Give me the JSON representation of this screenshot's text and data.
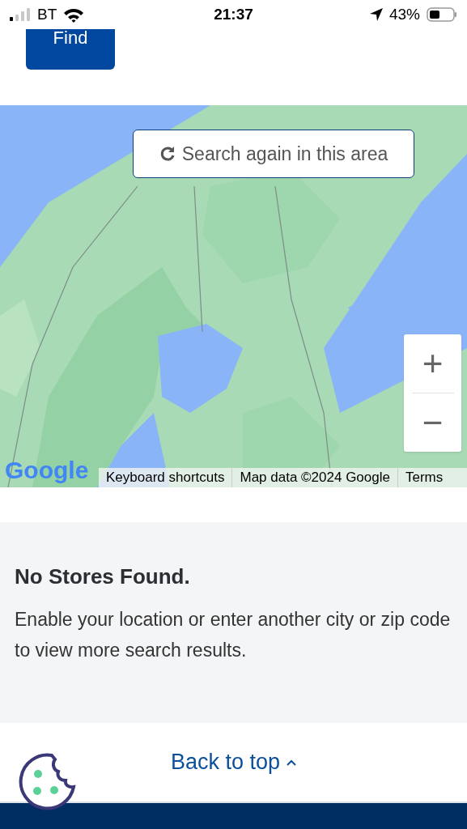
{
  "status_bar": {
    "carrier": "BT",
    "time": "21:37",
    "battery": "43%"
  },
  "find_button": {
    "label": "Find"
  },
  "map": {
    "search_again": "Search again in this area",
    "zoom_in": "+",
    "zoom_out": "−",
    "logo": "Google",
    "attribution": [
      "Keyboard shortcuts",
      "Map data ©2024 Google",
      "Terms"
    ]
  },
  "results": {
    "title": "No Stores Found.",
    "message": "Enable your location or enter another city or zip code to view more search results."
  },
  "footer": {
    "back_to_top": "Back to top"
  }
}
